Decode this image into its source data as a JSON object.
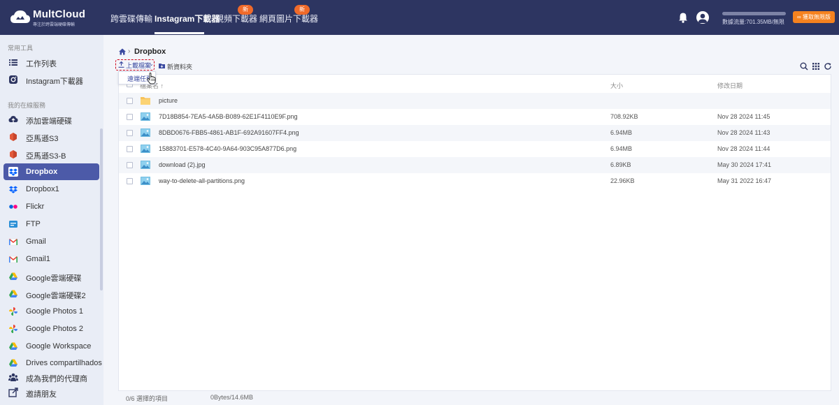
{
  "header": {
    "brand": "MultCloud",
    "tagline": "專注於跨雲端硬碟傳輸",
    "nav": [
      {
        "label": "跨雲碟傳輸"
      },
      {
        "label": "Instagram下載器"
      },
      {
        "label": "視頻下載器",
        "badge": "新"
      },
      {
        "label": "網頁圖片下載器",
        "badge": "新"
      }
    ],
    "traffic_text": "數據流量:701.35MB/無限",
    "unlimited_label": "獲取無限版"
  },
  "sidebar": {
    "section_common": "常用工具",
    "common_items": [
      {
        "label": "工作列表",
        "icon": "list-icon"
      },
      {
        "label": "Instagram下載器",
        "icon": "instagram-icon"
      }
    ],
    "section_drives": "我的在線服務",
    "drive_items": [
      {
        "label": "添加雲端硬碟",
        "icon": "add-cloud-icon"
      },
      {
        "label": "亞馬遜S3",
        "icon": "amazon-s3-icon"
      },
      {
        "label": "亞馬遜S3-B",
        "icon": "amazon-s3-icon"
      },
      {
        "label": "Dropbox",
        "icon": "dropbox-icon",
        "active": true
      },
      {
        "label": "Dropbox1",
        "icon": "dropbox-icon"
      },
      {
        "label": "Flickr",
        "icon": "flickr-icon"
      },
      {
        "label": "FTP",
        "icon": "ftp-icon"
      },
      {
        "label": "Gmail",
        "icon": "gmail-icon"
      },
      {
        "label": "Gmail1",
        "icon": "gmail-icon"
      },
      {
        "label": "Google雲端硬碟",
        "icon": "google-drive-icon"
      },
      {
        "label": "Google雲端硬碟2",
        "icon": "google-drive-icon"
      },
      {
        "label": "Google Photos 1",
        "icon": "google-photos-icon"
      },
      {
        "label": "Google Photos 2",
        "icon": "google-photos-icon"
      },
      {
        "label": "Google Workspace",
        "icon": "google-drive-icon"
      },
      {
        "label": "Drives compartilhados",
        "icon": "google-drive-icon"
      }
    ],
    "bottom_items": [
      {
        "label": "成為我們的代理商",
        "icon": "agent-icon"
      },
      {
        "label": "邀請朋友",
        "icon": "invite-icon"
      }
    ]
  },
  "main": {
    "breadcrumb_current": "Dropbox",
    "toolbar": {
      "upload_label": "上載檔案",
      "newfolder_label": "新資料夾",
      "upload_menu_item": "遠端任務"
    },
    "columns": {
      "name": "檔案名",
      "size": "大小",
      "date": "修改日期"
    },
    "files": [
      {
        "name": "picture",
        "type": "folder",
        "size": "",
        "date": ""
      },
      {
        "name": "7D18B854-7EA5-4A5B-B089-62E1F4110E9F.png",
        "type": "image",
        "size": "708.92KB",
        "date": "Nov 28 2024 11:45"
      },
      {
        "name": "8DBD0676-FBB5-4861-AB1F-692A91607FF4.png",
        "type": "image",
        "size": "6.94MB",
        "date": "Nov 28 2024 11:43"
      },
      {
        "name": "15883701-E578-4C40-9A64-903C95A877D6.png",
        "type": "image",
        "size": "6.94MB",
        "date": "Nov 28 2024 11:44"
      },
      {
        "name": "download (2).jpg",
        "type": "image",
        "size": "6.89KB",
        "date": "May 30 2024 17:41"
      },
      {
        "name": "way-to-delete-all-partitions.png",
        "type": "image",
        "size": "22.96KB",
        "date": "May 31 2022 16:47"
      }
    ],
    "footer": {
      "selected": "0/6 選擇的項目",
      "size": "0Bytes/14.6MB"
    }
  }
}
